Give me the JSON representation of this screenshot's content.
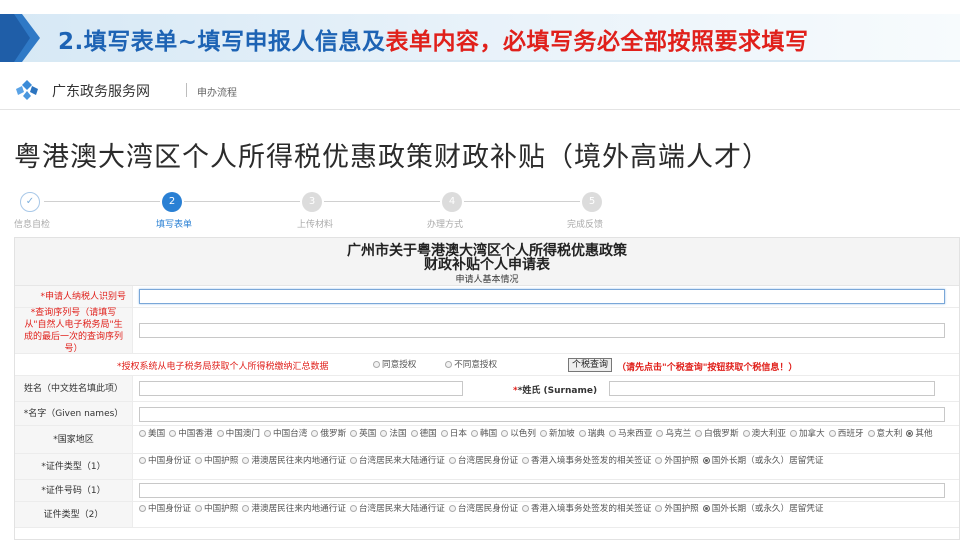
{
  "banner": {
    "title_part1": "2.填写表单~填写申报人信息及",
    "title_part2": "表单内容，必填写务必全部按照要求填写"
  },
  "site": {
    "name": "广东政务服务网",
    "nav_link": "申办流程"
  },
  "page_title": "粤港澳大湾区个人所得税优惠政策财政补贴（境外高端人才）",
  "steps": [
    {
      "number": "✓",
      "label": "信息自检",
      "state": "done"
    },
    {
      "number": "2",
      "label": "填写表单",
      "state": "active"
    },
    {
      "number": "3",
      "label": "上传材料",
      "state": "todo"
    },
    {
      "number": "4",
      "label": "办理方式",
      "state": "todo"
    },
    {
      "number": "5",
      "label": "完成反馈",
      "state": "todo"
    }
  ],
  "form": {
    "title_line1": "广州市关于粤港澳大湾区个人所得税优惠政策",
    "title_line2": "财政补贴个人申请表",
    "section": "申请人基本情况",
    "taxpayer_id_label": "*申请人纳税人识别号",
    "query_serial_label": "*查询序列号（请填写从\"自然人电子税务局\"生成的最后一次的查询序列号）",
    "auth_label": "*授权系统从电子税务局获取个人所得税缴纳汇总数据",
    "auth_options": [
      "同意授权",
      "不同意授权"
    ],
    "query_button": "个税查询",
    "query_note": "（请先点击\"个税查询\"按钮获取个税信息！）",
    "name_cn_label": "姓名（中文姓名填此项）",
    "surname_label": "*姓氏 (Surname)",
    "given_name_label": "*名字（Given names）",
    "country_label": "*国家地区",
    "countries": [
      "美国",
      "中国香港",
      "中国澳门",
      "中国台湾",
      "俄罗斯",
      "英国",
      "法国",
      "德国",
      "日本",
      "韩国",
      "以色列",
      "新加坡",
      "瑞典",
      "马来西亚",
      "乌克兰",
      "白俄罗斯",
      "澳大利亚",
      "加拿大",
      "西班牙",
      "意大利",
      "其他"
    ],
    "country_selected": "其他",
    "id_type1_label": "*证件类型（1）",
    "id_number1_label": "*证件号码（1）",
    "id_type2_label": "证件类型（2）",
    "id_types": [
      "中国身份证",
      "中国护照",
      "港澳居民往来内地通行证",
      "台湾居民来大陆通行证",
      "台湾居民身份证",
      "香港入境事务处签发的相关签证",
      "外国护照",
      "国外长期（或永久）居留凭证"
    ],
    "id_type_selected": "国外长期（或永久）居留凭证"
  },
  "colors": {
    "banner_blue": "#1d63b4",
    "banner_red": "#e0201b",
    "step_active": "#2a80d4"
  }
}
